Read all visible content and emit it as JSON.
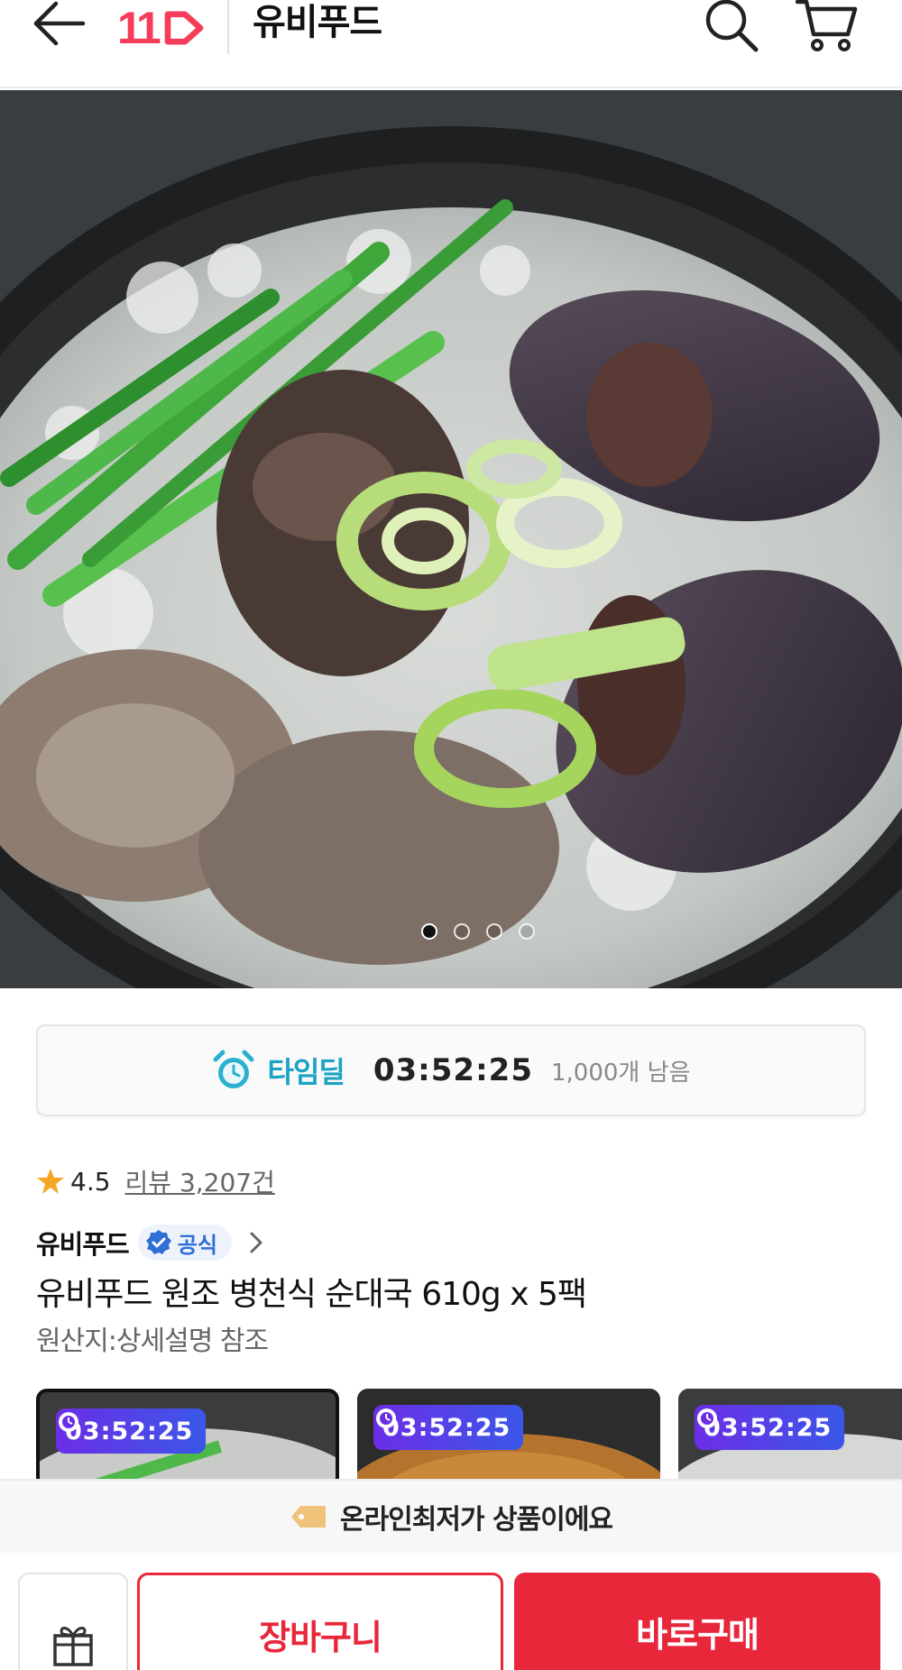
{
  "header": {
    "back_icon": "arrow-left-icon",
    "logo_text": "11",
    "store_name": "유비푸드",
    "search_icon": "search-icon",
    "cart_icon": "cart-icon",
    "brand_color": "#f53c5a"
  },
  "hero": {
    "image_subject": "순대국 뚝배기 사진",
    "page_dots": 4,
    "active_dot": 1
  },
  "timedeal": {
    "label": "타임딜",
    "timer": "03:52:25",
    "remaining": "1,000개 남음",
    "accent": "#1ba3c4"
  },
  "rating": {
    "value": "4.5",
    "reviews": "리뷰 3,207건"
  },
  "seller": {
    "name": "유비푸드",
    "badge": "공식"
  },
  "product": {
    "title": "유비푸드 원조 병천식 순대국 610g x 5팩",
    "origin": "원산지:상세설명 참조"
  },
  "thumbnails": [
    {
      "timer": "03:52:25",
      "selected": true
    },
    {
      "timer": "03:52:25",
      "selected": false
    },
    {
      "timer": "03:52:25",
      "selected": false
    }
  ],
  "banner": {
    "text": "온라인최저가 상품이에요"
  },
  "bottom": {
    "gift_icon": "gift-icon",
    "cart_label": "장바구니",
    "buy_label": "바로구매",
    "primary_color": "#e8273b"
  }
}
